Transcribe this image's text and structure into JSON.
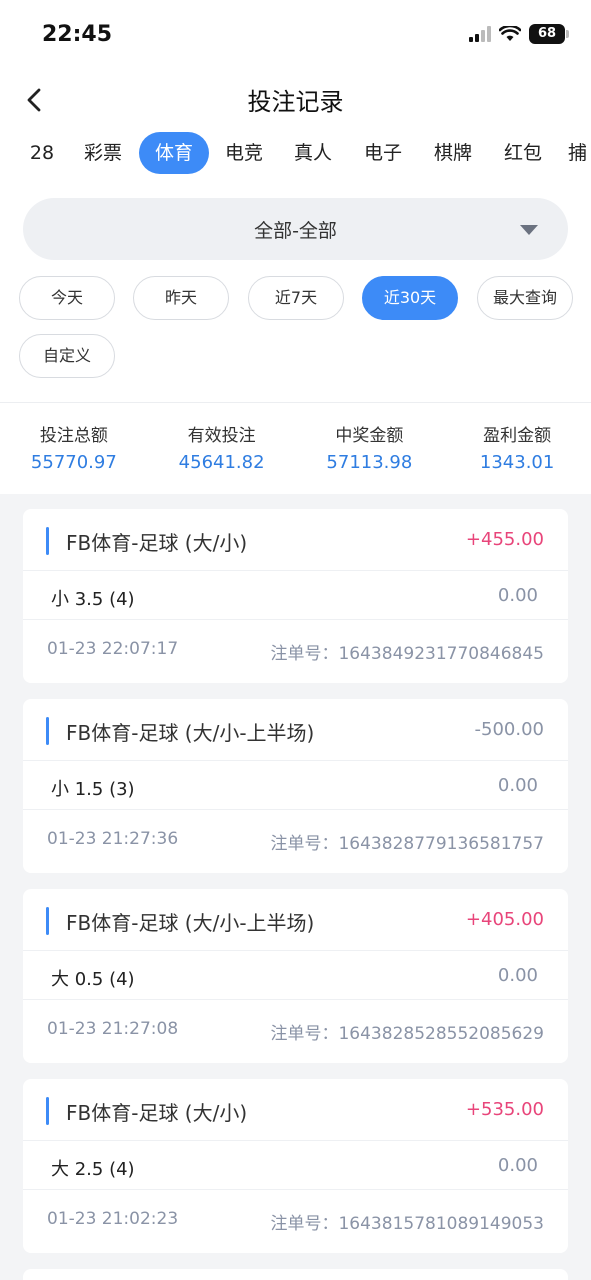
{
  "status": {
    "time": "22:45",
    "battery": "68"
  },
  "nav": {
    "title": "投注记录"
  },
  "tabs": [
    "28",
    "彩票",
    "体育",
    "电竞",
    "真人",
    "电子",
    "棋牌",
    "红包",
    "捕"
  ],
  "active_tab": "体育",
  "filter": {
    "label": "全部-全部"
  },
  "date_chips": [
    "今天",
    "昨天",
    "近7天",
    "近30天",
    "最大查询",
    "自定义"
  ],
  "active_chip": "近30天",
  "summary": [
    {
      "label": "投注总额",
      "value": "55770.97"
    },
    {
      "label": "有效投注",
      "value": "45641.82"
    },
    {
      "label": "中奖金额",
      "value": "57113.98"
    },
    {
      "label": "盈利金额",
      "value": "1343.01"
    }
  ],
  "records": [
    {
      "title": "FB体育-足球 (大/小)",
      "amount": "+455.00",
      "amount_type": "pos",
      "pick": "小 3.5 (4)",
      "value": "0.00",
      "time": "01-23 22:07:17",
      "order_label": "注单号：",
      "order_no": "1643849231770846845"
    },
    {
      "title": "FB体育-足球 (大/小-上半场)",
      "amount": "-500.00",
      "amount_type": "neg",
      "pick": "小 1.5 (3)",
      "value": "0.00",
      "time": "01-23 21:27:36",
      "order_label": "注单号：",
      "order_no": "1643828779136581757"
    },
    {
      "title": "FB体育-足球 (大/小-上半场)",
      "amount": "+405.00",
      "amount_type": "pos",
      "pick": "大 0.5 (4)",
      "value": "0.00",
      "time": "01-23 21:27:08",
      "order_label": "注单号：",
      "order_no": "1643828528552085629"
    },
    {
      "title": "FB体育-足球 (大/小)",
      "amount": "+535.00",
      "amount_type": "pos",
      "pick": "大 2.5 (4)",
      "value": "0.00",
      "time": "01-23 21:02:23",
      "order_label": "注单号：",
      "order_no": "1643815781089149053"
    }
  ],
  "colors": {
    "accent": "#3d8bf7",
    "positive": "#e8457a",
    "negative": "#8a93a6",
    "summary_value": "#2f7de1"
  }
}
